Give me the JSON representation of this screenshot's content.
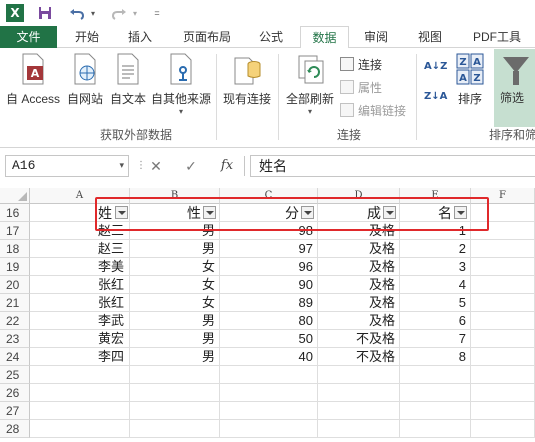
{
  "qat": {
    "logo": "X",
    "items": [
      "save-icon",
      "undo-icon",
      "redo-icon",
      "customize-icon"
    ]
  },
  "tabs": [
    {
      "label": "文件",
      "active": false,
      "file": true
    },
    {
      "label": "开始",
      "active": false
    },
    {
      "label": "插入",
      "active": false
    },
    {
      "label": "页面布局",
      "active": false
    },
    {
      "label": "公式",
      "active": false
    },
    {
      "label": "数据",
      "active": true
    },
    {
      "label": "审阅",
      "active": false
    },
    {
      "label": "视图",
      "active": false
    },
    {
      "label": "PDF工具",
      "active": false
    }
  ],
  "ribbon": {
    "external": {
      "buttons": [
        "自 Access",
        "自网站",
        "自文本",
        "自其他来源"
      ],
      "group_label": "获取外部数据"
    },
    "existing_connections": "现有连接",
    "connections": {
      "refresh_all": "全部刷新",
      "connections": "连接",
      "properties": "属性",
      "edit_links": "编辑链接",
      "group_label": "连接"
    },
    "sort": {
      "label": "排序",
      "az": "A↓Z",
      "za": "Z↓A"
    },
    "filter": "筛选",
    "sort_filter_group_label": "排序和筛"
  },
  "formula_bar": {
    "name_box": "A16",
    "formula": "姓名",
    "fx": "fx"
  },
  "sheet": {
    "columns": [
      "A",
      "B",
      "C",
      "D",
      "E",
      "F"
    ],
    "rows": [
      "16",
      "17",
      "18",
      "19",
      "20",
      "21",
      "22",
      "23",
      "24",
      "25",
      "26",
      "27",
      "28"
    ],
    "header_row": [
      "姓",
      "性",
      "分",
      "成",
      "名"
    ],
    "data": [
      [
        "赵三",
        "男",
        "98",
        "及格",
        "1"
      ],
      [
        "赵三",
        "男",
        "97",
        "及格",
        "2"
      ],
      [
        "李美",
        "女",
        "96",
        "及格",
        "3"
      ],
      [
        "张红",
        "女",
        "90",
        "及格",
        "4"
      ],
      [
        "张红",
        "女",
        "89",
        "及格",
        "5"
      ],
      [
        "李武",
        "男",
        "80",
        "及格",
        "6"
      ],
      [
        "黄宏",
        "男",
        "50",
        "不及格",
        "7"
      ],
      [
        "李四",
        "男",
        "40",
        "不及格",
        "8"
      ]
    ]
  },
  "colors": {
    "excel_green": "#217346",
    "highlight_box": "#e0292b",
    "filter_active": "#c6dfd0"
  }
}
